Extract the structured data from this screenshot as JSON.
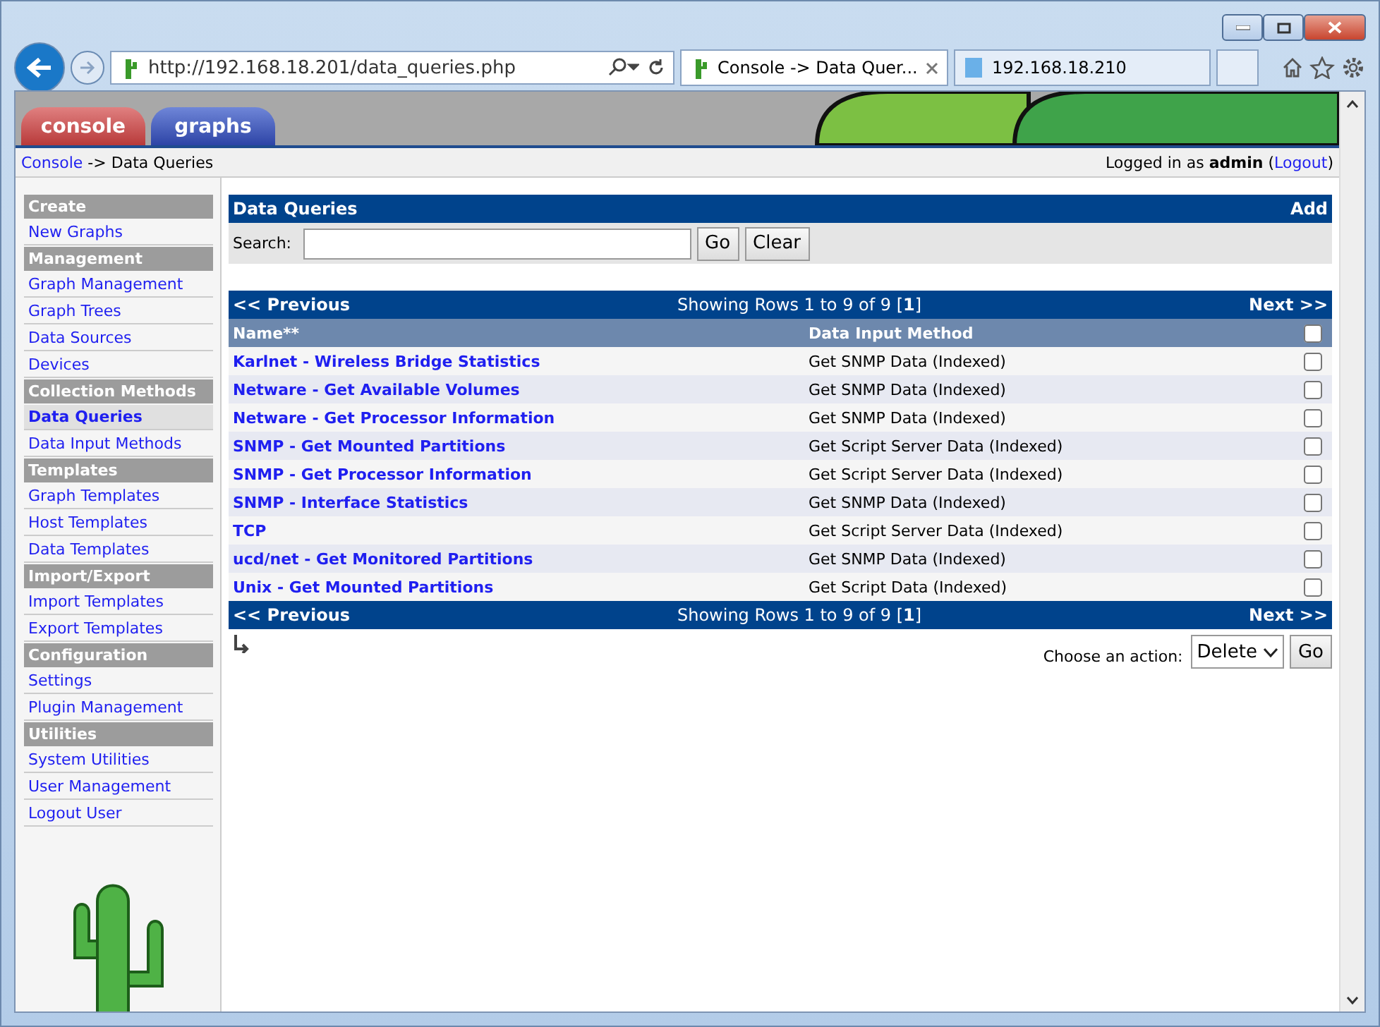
{
  "browser": {
    "address": "http://192.168.18.201/data_queries.php",
    "tabs": [
      {
        "label": "Console -> Data Quer...",
        "selected": true
      },
      {
        "label": "192.168.18.210",
        "selected": false
      }
    ]
  },
  "header": {
    "tabs": [
      {
        "label": "console",
        "selected": true
      },
      {
        "label": "graphs",
        "selected": false
      }
    ]
  },
  "breadcrumb": {
    "link": "Console",
    "rest": "-> Data Queries"
  },
  "login": {
    "text": "Logged in as **admin** (",
    "link": "Logout",
    "close": ")"
  },
  "sidebar": [
    {
      "title": "Create",
      "items": [
        {
          "label": "New Graphs",
          "selected": false
        }
      ]
    },
    {
      "title": "Management",
      "items": [
        {
          "label": "Graph Management",
          "selected": false
        },
        {
          "label": "Graph Trees",
          "selected": false
        },
        {
          "label": "Data Sources",
          "selected": false
        },
        {
          "label": "Devices",
          "selected": false
        }
      ]
    },
    {
      "title": "Collection Methods",
      "items": [
        {
          "label": "Data Queries",
          "selected": true
        },
        {
          "label": "Data Input Methods",
          "selected": false
        }
      ]
    },
    {
      "title": "Templates",
      "items": [
        {
          "label": "Graph Templates",
          "selected": false
        },
        {
          "label": "Host Templates",
          "selected": false
        },
        {
          "label": "Data Templates",
          "selected": false
        }
      ]
    },
    {
      "title": "Import/Export",
      "items": [
        {
          "label": "Import Templates",
          "selected": false
        },
        {
          "label": "Export Templates",
          "selected": false
        }
      ]
    },
    {
      "title": "Configuration",
      "items": [
        {
          "label": "Settings",
          "selected": false
        },
        {
          "label": "Plugin Management",
          "selected": false
        }
      ]
    },
    {
      "title": "Utilities",
      "items": [
        {
          "label": "System Utilities",
          "selected": false
        },
        {
          "label": "User Management",
          "selected": false
        },
        {
          "label": "Logout User",
          "selected": false
        }
      ]
    }
  ],
  "panel": {
    "title": "Data Queries",
    "add": "Add",
    "search_label": "Search:",
    "go": "Go",
    "clear": "Clear"
  },
  "pager_top": {
    "previous": "<< Previous",
    "info": "Showing Rows 1 to 9 of 9 [**1**]",
    "next": "Next >>"
  },
  "table": {
    "columns": [
      "Name**",
      "Data Input Method"
    ],
    "select_all": false,
    "rows": [
      {
        "name": "Karlnet - Wireless Bridge Statistics",
        "method": "Get SNMP Data (Indexed)",
        "checked": false
      },
      {
        "name": "Netware - Get Available Volumes",
        "method": "Get SNMP Data (Indexed)",
        "checked": false
      },
      {
        "name": "Netware - Get Processor Information",
        "method": "Get SNMP Data (Indexed)",
        "checked": false
      },
      {
        "name": "SNMP - Get Mounted Partitions",
        "method": "Get Script Server Data (Indexed)",
        "checked": false
      },
      {
        "name": "SNMP - Get Processor Information",
        "method": "Get Script Server Data (Indexed)",
        "checked": false
      },
      {
        "name": "SNMP - Interface Statistics",
        "method": "Get SNMP Data (Indexed)",
        "checked": false
      },
      {
        "name": "TCP",
        "method": "Get Script Server Data (Indexed)",
        "checked": false
      },
      {
        "name": "ucd/net - Get Monitored Partitions",
        "method": "Get SNMP Data (Indexed)",
        "checked": false
      },
      {
        "name": "Unix - Get Mounted Partitions",
        "method": "Get Script Data (Indexed)",
        "checked": false
      }
    ]
  },
  "pager_bottom": {
    "previous": "<< Previous",
    "info": "Showing Rows 1 to 9 of 9 [**1**]",
    "next": "Next >>"
  },
  "actions": {
    "label": "Choose an action:",
    "value": "Delete",
    "go": "Go"
  }
}
